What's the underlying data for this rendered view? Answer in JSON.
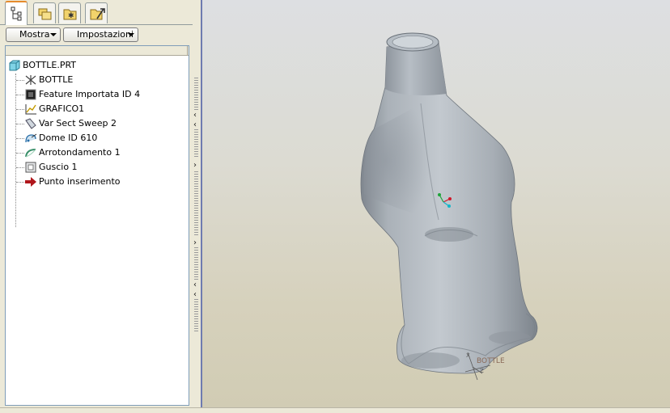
{
  "sidebar": {
    "tabs": [
      {
        "name": "model-tree",
        "icon": "model-tree-icon",
        "active": true
      },
      {
        "name": "folder-browser",
        "icon": "folder-browser-icon",
        "active": false
      },
      {
        "name": "favorites",
        "icon": "favorites-folder-icon",
        "active": false
      },
      {
        "name": "connections",
        "icon": "connections-icon",
        "active": false
      }
    ],
    "toolbar": {
      "show_label": "Mostra",
      "settings_label": "Impostazioni"
    },
    "tree": {
      "root": {
        "label": "BOTTLE.PRT",
        "icon": "part-icon"
      },
      "items": [
        {
          "label": "BOTTLE",
          "icon": "coordinate-system-icon"
        },
        {
          "label": "Feature Importata ID 4",
          "icon": "imported-feature-icon"
        },
        {
          "label": "GRAFICO1",
          "icon": "graph-icon"
        },
        {
          "label": "Var Sect Sweep 2",
          "icon": "sweep-icon"
        },
        {
          "label": "Dome ID 610",
          "icon": "dome-icon"
        },
        {
          "label": "Arrotondamento 1",
          "icon": "round-icon"
        },
        {
          "label": "Guscio 1",
          "icon": "shell-icon"
        },
        {
          "label": "Punto inserimento",
          "icon": "insert-here-arrow-icon"
        }
      ]
    }
  },
  "viewport": {
    "csys_label": "BOTTLE",
    "colors": {
      "model_surface": "#9fa6ae",
      "background_top": "#dddfe2",
      "background_bottom": "#d1ccb4",
      "csys_label": "#8a6a58"
    }
  }
}
